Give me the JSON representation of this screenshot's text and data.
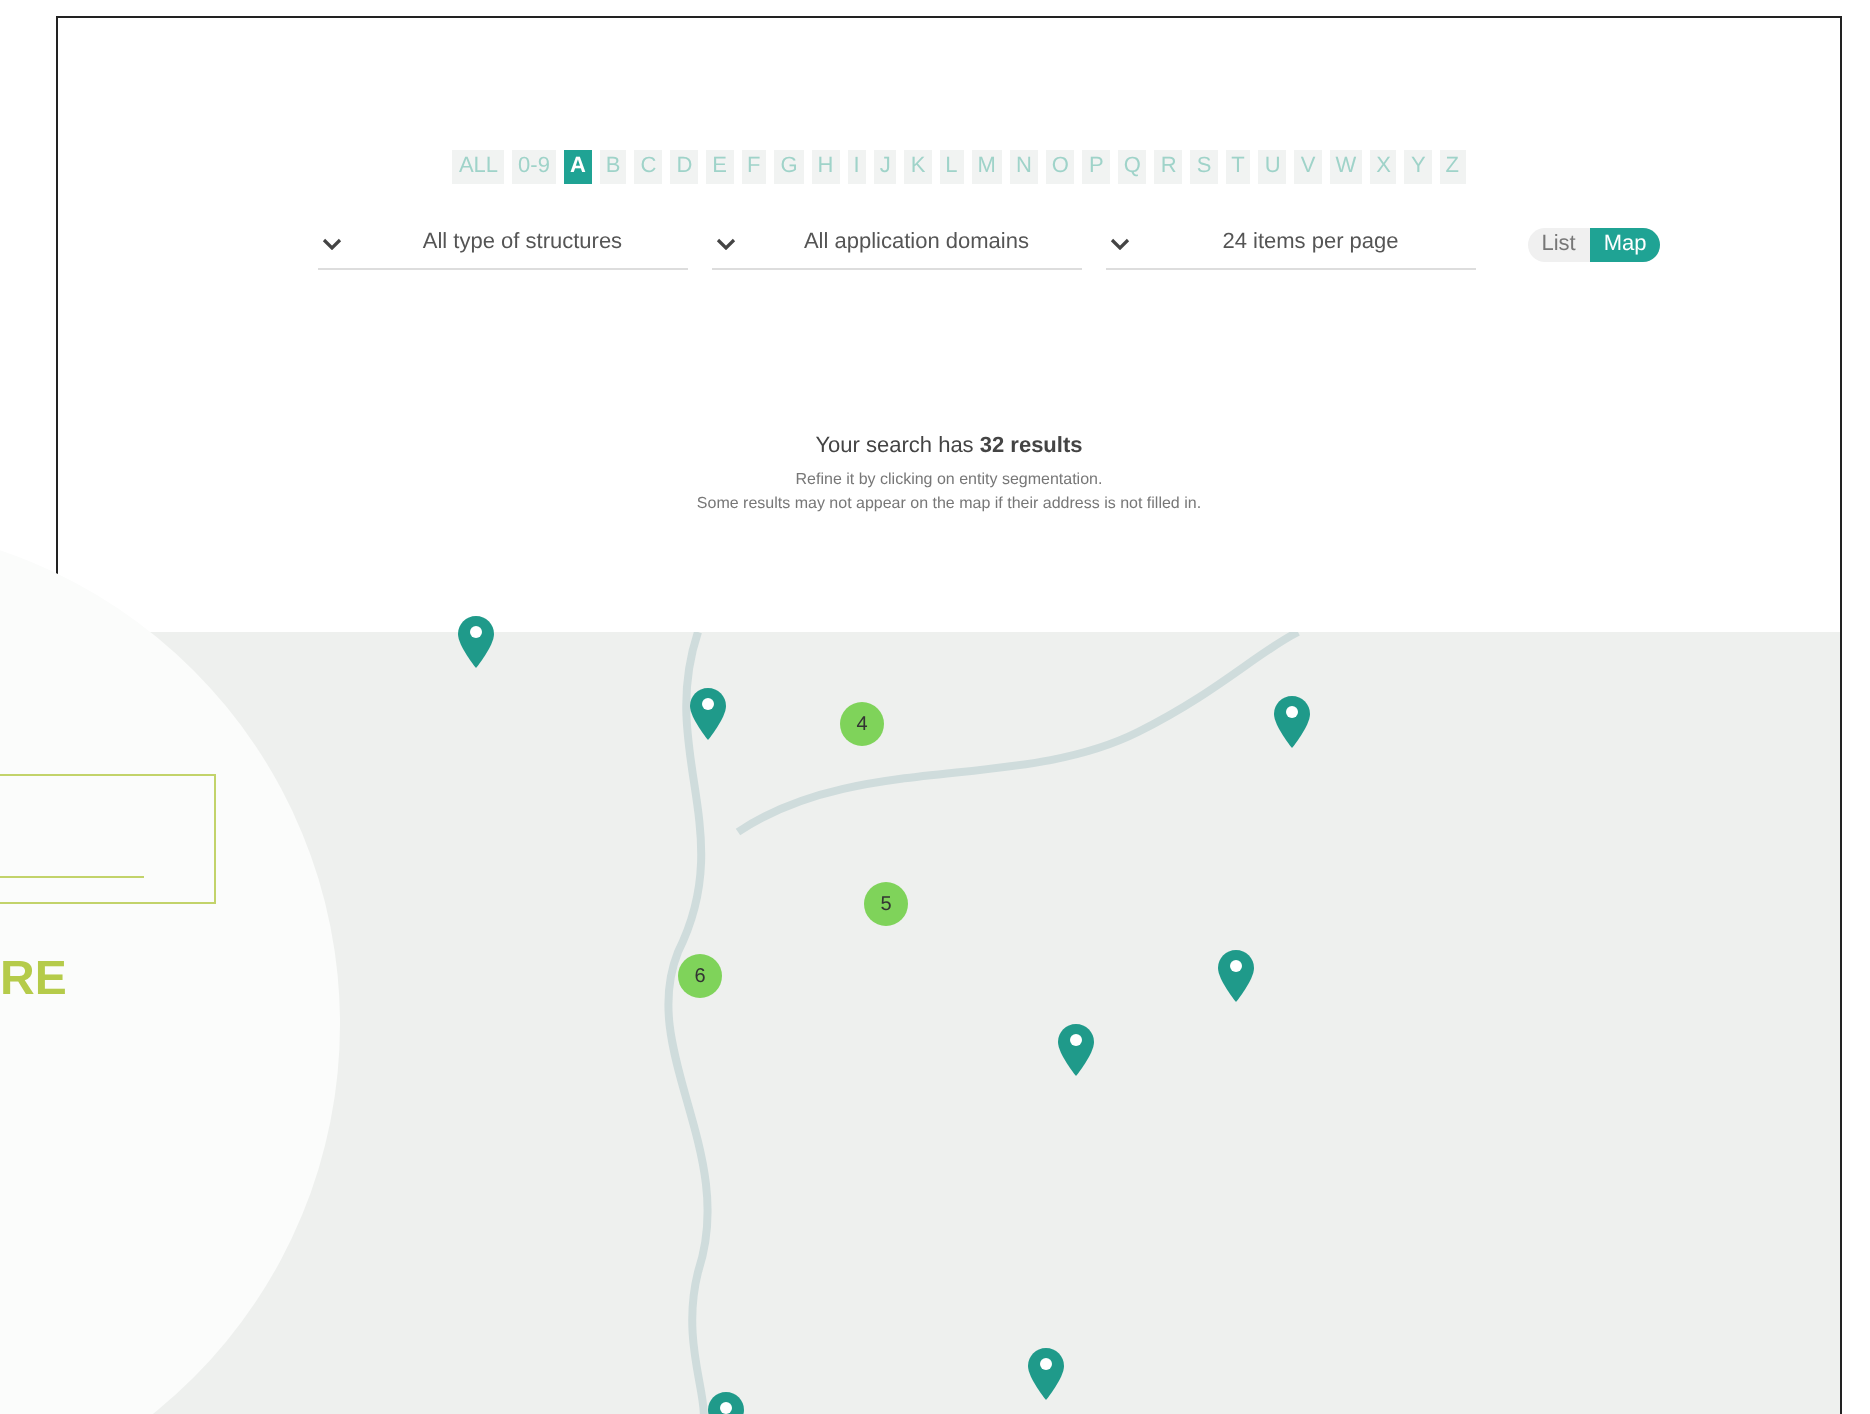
{
  "letters": [
    {
      "label": "ALL",
      "selected": false
    },
    {
      "label": "0-9",
      "selected": false
    },
    {
      "label": "A",
      "selected": true
    },
    {
      "label": "B",
      "selected": false
    },
    {
      "label": "C",
      "selected": false
    },
    {
      "label": "D",
      "selected": false
    },
    {
      "label": "E",
      "selected": false
    },
    {
      "label": "F",
      "selected": false
    },
    {
      "label": "G",
      "selected": false
    },
    {
      "label": "H",
      "selected": false
    },
    {
      "label": "I",
      "selected": false
    },
    {
      "label": "J",
      "selected": false
    },
    {
      "label": "K",
      "selected": false
    },
    {
      "label": "L",
      "selected": false
    },
    {
      "label": "M",
      "selected": false
    },
    {
      "label": "N",
      "selected": false
    },
    {
      "label": "O",
      "selected": false
    },
    {
      "label": "P",
      "selected": false
    },
    {
      "label": "Q",
      "selected": false
    },
    {
      "label": "R",
      "selected": false
    },
    {
      "label": "S",
      "selected": false
    },
    {
      "label": "T",
      "selected": false
    },
    {
      "label": "U",
      "selected": false
    },
    {
      "label": "V",
      "selected": false
    },
    {
      "label": "W",
      "selected": false
    },
    {
      "label": "X",
      "selected": false
    },
    {
      "label": "Y",
      "selected": false
    },
    {
      "label": "Z",
      "selected": false
    }
  ],
  "filters": [
    {
      "value": "All type of structures"
    },
    {
      "value": "All application domains"
    },
    {
      "value": "24 items per page"
    }
  ],
  "view_toggle": [
    {
      "label": "List",
      "selected": false
    },
    {
      "label": "Map",
      "selected": true
    }
  ],
  "results": {
    "summary": "Your search has **32 results**",
    "hint": "Refine it by clicking on entity segmentation.",
    "note": "Some results may not appear on the map if their address is not filled in."
  },
  "map": {
    "markers": [
      {
        "kind": "pin"
      },
      {
        "kind": "pin"
      },
      {
        "kind": "cluster",
        "count": "4"
      },
      {
        "kind": "pin"
      },
      {
        "kind": "cluster",
        "count": "5"
      },
      {
        "kind": "cluster",
        "count": "6"
      },
      {
        "kind": "pin"
      },
      {
        "kind": "pin"
      },
      {
        "kind": "pin"
      },
      {
        "kind": "pin"
      }
    ]
  },
  "side_panel": {
    "heading": "RE"
  }
}
